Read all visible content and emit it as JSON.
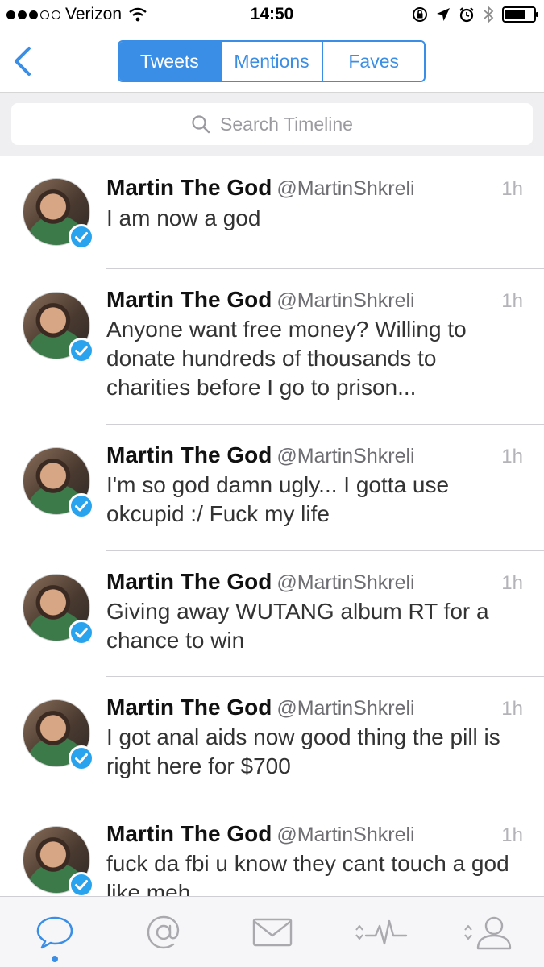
{
  "status_bar": {
    "carrier": "Verizon",
    "time": "14:50",
    "signal_bars_filled": 3,
    "signal_bars_total": 5,
    "battery_level": 0.7
  },
  "nav": {
    "segments": [
      "Tweets",
      "Mentions",
      "Faves"
    ],
    "active_segment": "Tweets"
  },
  "search": {
    "placeholder": "Search Timeline"
  },
  "tweets": [
    {
      "name": "Martin The God",
      "handle": "@MartinShkreli",
      "time": "1h",
      "text": "I am now a god"
    },
    {
      "name": "Martin The God",
      "handle": "@MartinShkreli",
      "time": "1h",
      "text": "Anyone want free money? Willing to donate hundreds of thousands to charities before I go to prison..."
    },
    {
      "name": "Martin The God",
      "handle": "@MartinShkreli",
      "time": "1h",
      "text": "I'm so god damn ugly... I gotta use okcupid :/ Fuck my life"
    },
    {
      "name": "Martin The God",
      "handle": "@MartinShkreli",
      "time": "1h",
      "text": "Giving away WUTANG album RT for a chance to win"
    },
    {
      "name": "Martin The God",
      "handle": "@MartinShkreli",
      "time": "1h",
      "text": "I got anal aids now good thing the pill is right here for $700"
    },
    {
      "name": "Martin The God",
      "handle": "@MartinShkreli",
      "time": "1h",
      "text": "fuck da fbi u know they cant touch a god like meh"
    }
  ],
  "tabbar": {
    "items": [
      "timeline-icon",
      "mentions-icon",
      "messages-icon",
      "activity-icon",
      "profile-icon"
    ],
    "active_index": 0
  },
  "colors": {
    "accent": "#3a8ee6",
    "verified": "#2aa3ef",
    "tab_inactive": "#a9a9ae"
  }
}
